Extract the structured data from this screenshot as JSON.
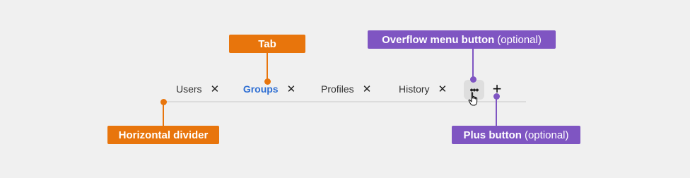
{
  "tabs": [
    {
      "label": "Users",
      "close": "✕",
      "active": false
    },
    {
      "label": "Groups",
      "close": "✕",
      "active": true
    },
    {
      "label": "Profiles",
      "close": "✕",
      "active": false
    },
    {
      "label": "History",
      "close": "✕",
      "active": false
    }
  ],
  "overflow_button": {
    "glyph": "•••"
  },
  "plus_button": {
    "glyph": "+"
  },
  "callouts": {
    "tab": {
      "label": "Tab"
    },
    "divider": {
      "label": "Horizontal divider"
    },
    "overflow": {
      "label": "Overflow menu button",
      "suffix": "(optional)"
    },
    "plus": {
      "label": "Plus button",
      "suffix": "(optional)"
    }
  },
  "colors": {
    "accent": "#2f6fd3",
    "callout_orange": "#e8750c",
    "callout_purple": "#7f55c2",
    "divider": "#dcdcdc",
    "background": "#f0f0f0"
  }
}
